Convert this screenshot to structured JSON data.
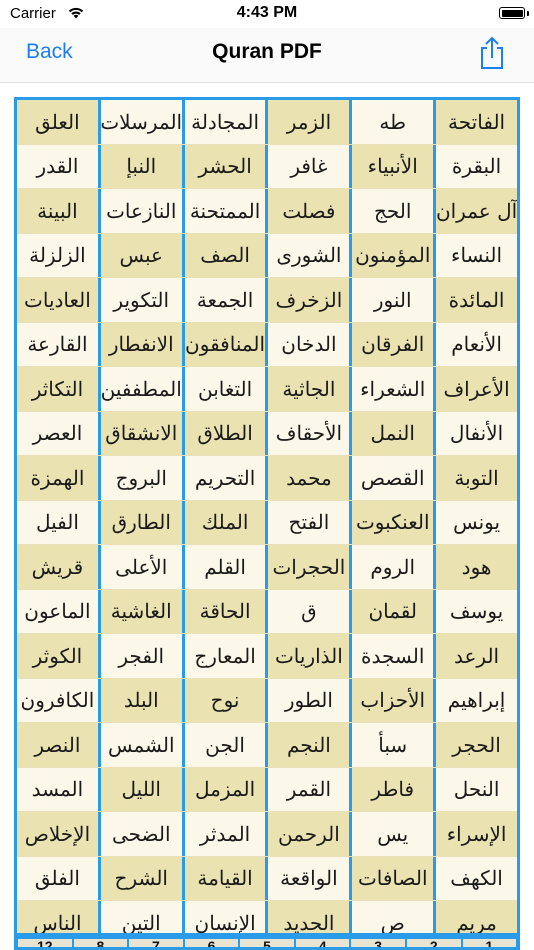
{
  "status": {
    "carrier": "Carrier",
    "time": "4:43 PM"
  },
  "nav": {
    "back_label": "Back",
    "title": "Quran PDF"
  },
  "grid": {
    "rows": [
      [
        "العلق",
        "المرسلات",
        "المجادلة",
        "الزمر",
        "طه",
        "الفاتحة"
      ],
      [
        "القدر",
        "النبإ",
        "الحشر",
        "غافر",
        "الأنبياء",
        "البقرة"
      ],
      [
        "البينة",
        "النازعات",
        "الممتحنة",
        "فصلت",
        "الحج",
        "آل عمران"
      ],
      [
        "الزلزلة",
        "عبس",
        "الصف",
        "الشورى",
        "المؤمنون",
        "النساء"
      ],
      [
        "العاديات",
        "التكوير",
        "الجمعة",
        "الزخرف",
        "النور",
        "المائدة"
      ],
      [
        "القارعة",
        "الانفطار",
        "المنافقون",
        "الدخان",
        "الفرقان",
        "الأنعام"
      ],
      [
        "التكاثر",
        "المطففين",
        "التغابن",
        "الجاثية",
        "الشعراء",
        "الأعراف"
      ],
      [
        "العصر",
        "الانشقاق",
        "الطلاق",
        "الأحقاف",
        "النمل",
        "الأنفال"
      ],
      [
        "الهمزة",
        "البروج",
        "التحريم",
        "محمد",
        "القصص",
        "التوبة"
      ],
      [
        "الفيل",
        "الطارق",
        "الملك",
        "الفتح",
        "العنكبوت",
        "يونس"
      ],
      [
        "قريش",
        "الأعلى",
        "القلم",
        "الحجرات",
        "الروم",
        "هود"
      ],
      [
        "الماعون",
        "الغاشية",
        "الحاقة",
        "ق",
        "لقمان",
        "يوسف"
      ],
      [
        "الكوثر",
        "الفجر",
        "المعارج",
        "الذاريات",
        "السجدة",
        "الرعد"
      ],
      [
        "الكافرون",
        "البلد",
        "نوح",
        "الطور",
        "الأحزاب",
        "إبراهيم"
      ],
      [
        "النصر",
        "الشمس",
        "الجن",
        "النجم",
        "سبأ",
        "الحجر"
      ],
      [
        "المسد",
        "الليل",
        "المزمل",
        "القمر",
        "فاطر",
        "النحل"
      ],
      [
        "الإخلاص",
        "الضحى",
        "المدثر",
        "الرحمن",
        "يس",
        "الإسراء"
      ],
      [
        "الفلق",
        "الشرح",
        "القيامة",
        "الواقعة",
        "الصافات",
        "الكهف"
      ],
      [
        "الناس",
        "التين",
        "الإنسان",
        "الحديد",
        "ص",
        "مريم"
      ]
    ],
    "footer_numbers": [
      "12",
      "8",
      "7",
      "6",
      "5",
      "4",
      "3",
      "2",
      "1"
    ]
  },
  "colors": {
    "accent": "#1a7ef4",
    "frame": "#2a9be8",
    "cream": "#ebe2b2",
    "light": "#fbf8ea"
  },
  "icons": {
    "share": "share-icon",
    "wifi": "wifi-icon",
    "battery": "battery-icon"
  }
}
